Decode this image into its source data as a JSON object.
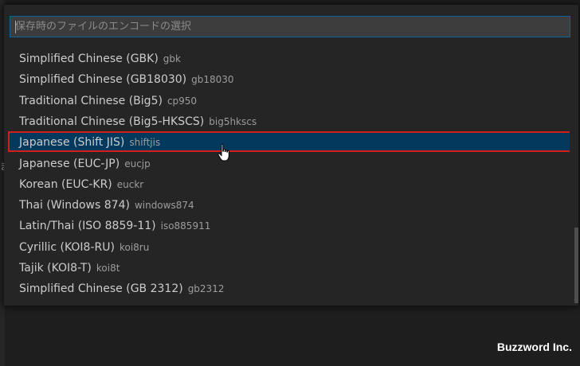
{
  "quick_pick": {
    "placeholder": "保存時のファイルのエンコードの選択",
    "items": [
      {
        "label": "Simplified Chinese (GBK)",
        "description": "gbk"
      },
      {
        "label": "Simplified Chinese (GB18030)",
        "description": "gb18030"
      },
      {
        "label": "Traditional Chinese (Big5)",
        "description": "cp950"
      },
      {
        "label": "Traditional Chinese (Big5-HKSCS)",
        "description": "big5hkscs"
      },
      {
        "label": "Japanese (Shift JIS)",
        "description": "shiftjis",
        "selected": true
      },
      {
        "label": "Japanese (EUC-JP)",
        "description": "eucjp"
      },
      {
        "label": "Korean (EUC-KR)",
        "description": "euckr"
      },
      {
        "label": "Thai (Windows 874)",
        "description": "windows874"
      },
      {
        "label": "Latin/Thai (ISO 8859-11)",
        "description": "iso885911"
      },
      {
        "label": "Cyrillic (KOI8-RU)",
        "description": "koi8ru"
      },
      {
        "label": "Tajik (KOI8-T)",
        "description": "koi8t"
      },
      {
        "label": "Simplified Chinese (GB 2312)",
        "description": "gb2312"
      }
    ]
  },
  "editor": {
    "stray_char": "ま"
  },
  "watermark": "Buzzword Inc.",
  "colors": {
    "background": "#1e1e1e",
    "panel": "#252526",
    "input_border": "#0e639c",
    "selection_background": "#04395e",
    "highlight_box": "#d11f1f",
    "label_text": "#cccccc",
    "description_text": "#9d9d9d"
  },
  "icons": {
    "pointer": "hand-pointer-icon"
  }
}
